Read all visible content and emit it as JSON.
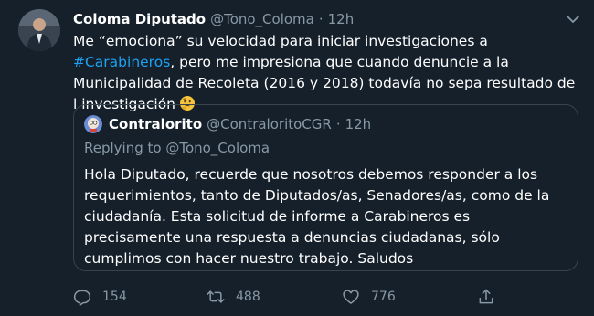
{
  "tweet": {
    "author_name": "Coloma Diputado",
    "author_handle": "@Tono_Coloma",
    "separator": "·",
    "time": "12h",
    "text_part1": "Me “emociona” su velocidad para iniciar investigaciones a ",
    "hashtag": "#Carabineros",
    "text_part2": ", pero me impresiona que cuando denuncie a la Municipalidad de Recoleta (2016 y 2018) todavía no sepa resultado de l investigación",
    "emoji": "thinking-face-icon"
  },
  "quoted": {
    "author_name": "Contralorito",
    "author_handle": "@ContraloritoCGR",
    "separator": "·",
    "time": "12h",
    "replying_to": "Replying to @Tono_Coloma",
    "text": "Hola Diputado, recuerde que nosotros debemos responder a los requerimientos, tanto de Diputados/as, Senadores/as, como de la ciudadanía. Esta solicitud de informe a Carabineros es precisamente una respuesta a denuncias ciudadanas, sólo cumplimos con hacer nuestro trabajo. Saludos"
  },
  "actions": {
    "reply_count": "154",
    "retweet_count": "488",
    "like_count": "776"
  },
  "colors": {
    "background": "#15202b",
    "secondary_text": "#8899a6",
    "link": "#1da1f2",
    "border": "#38444d"
  }
}
